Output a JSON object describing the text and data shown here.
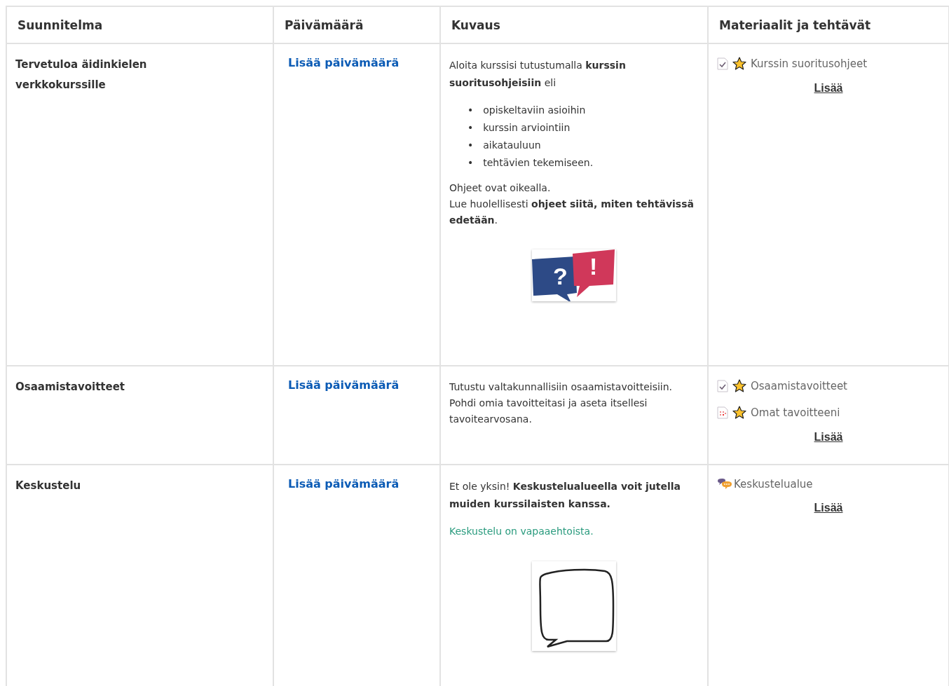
{
  "table": {
    "columns": [
      "Suunnitelma",
      "Päivämäärä",
      "Kuvaus",
      "Materiaalit ja tehtävät"
    ],
    "rows": [
      {
        "plan": "Tervetuloa äidinkielen verkkokurssille",
        "date_link": "Lisää päivämäärä",
        "description": [
          {
            "kind": "paragraph",
            "text": "Aloita kurssisi tutustumalla **kurssin suoritusohjeisiin** eli"
          },
          {
            "kind": "list",
            "bullet": "•",
            "items": [
              "opiskeltaviin asioihin",
              "kurssin arviointiin",
              "aikatauluun",
              "tehtävien tekemiseen."
            ]
          },
          {
            "kind": "lines",
            "lines": [
              "Ohjeet ovat oikealla.",
              "Lue huolellisesti **ohjeet siitä, miten tehtävissä edetään**."
            ]
          },
          {
            "kind": "qa_image",
            "question": "?",
            "exclaim": "!"
          }
        ],
        "materials": [
          {
            "kind": "page",
            "label": "Kurssin suoritusohjeet",
            "starred": true
          }
        ],
        "more": "Lisää"
      },
      {
        "plan": "Osaamistavoitteet",
        "date_link": "Lisää päivämäärä",
        "description": [
          {
            "kind": "lines",
            "lines": [
              "Tutustu valtakunnallisiin osaamistavoitteisiin.",
              "Pohdi omia tavoitteitasi ja aseta itsellesi tavoitearvosana."
            ]
          }
        ],
        "materials": [
          {
            "kind": "page",
            "label": "Osaamistavoitteet",
            "starred": true
          },
          {
            "kind": "sheet",
            "label": "Omat tavoitteeni",
            "starred": true
          }
        ],
        "more": "Lisää"
      },
      {
        "plan": "Keskustelu",
        "date_link": "Lisää päivämäärä",
        "description": [
          {
            "kind": "paragraph",
            "text": "Et ole yksin! **Keskustelualueella voit jutella muiden kurssilaisten kanssa.**"
          },
          {
            "kind": "note",
            "text": "Keskustelu on vapaaehtoista."
          },
          {
            "kind": "bubble_image"
          }
        ],
        "materials": [
          {
            "kind": "forum",
            "label": "Keskustelualue",
            "starred": false
          }
        ],
        "more": "Lisää"
      }
    ]
  }
}
